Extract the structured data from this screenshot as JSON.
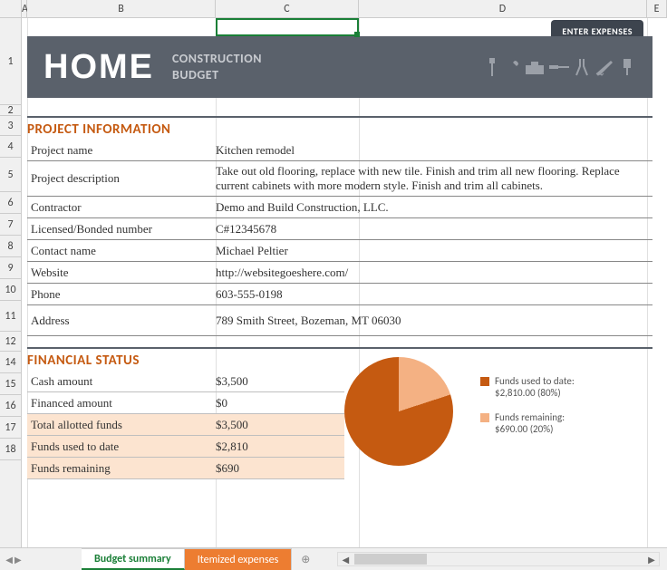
{
  "columns": [
    "A",
    "B",
    "C",
    "D",
    "E"
  ],
  "rows": [
    "1",
    "2",
    "3",
    "4",
    "5",
    "6",
    "7",
    "8",
    "9",
    "10",
    "11",
    "12",
    "14",
    "15",
    "16",
    "17",
    "18"
  ],
  "banner": {
    "title": "HOME",
    "subtitle_line1": "CONSTRUCTION",
    "subtitle_line2": "BUDGET",
    "enter_expenses": "ENTER EXPENSES"
  },
  "sections": {
    "project_info_title": "PROJECT INFORMATION",
    "financial_title": "FINANCIAL STATUS"
  },
  "project": {
    "name_label": "Project name",
    "name_value": "Kitchen remodel",
    "desc_label": "Project description",
    "desc_value": "Take out old flooring, replace with new tile. Finish and trim all new flooring. Replace current cabinets with more modern style. Finish and trim all cabinets.",
    "contractor_label": "Contractor",
    "contractor_value": "Demo and Build Construction, LLC.",
    "license_label": "Licensed/Bonded number",
    "license_value": "C#12345678",
    "contact_label": "Contact name",
    "contact_value": "Michael Peltier",
    "website_label": "Website",
    "website_value": "http://websitegoeshere.com/",
    "phone_label": "Phone",
    "phone_value": "603-555-0198",
    "address_label": "Address",
    "address_value": "789 Smith Street, Bozeman, MT 06030"
  },
  "financial": {
    "cash_label": "Cash amount",
    "cash_value": "$3,500",
    "financed_label": "Financed amount",
    "financed_value": "$0",
    "total_label": "Total allotted funds",
    "total_value": "$3,500",
    "used_label": "Funds used to date",
    "used_value": "$2,810",
    "remaining_label": "Funds remaining",
    "remaining_value": "$690"
  },
  "chart_data": {
    "type": "pie",
    "series": [
      {
        "name": "Funds used to date:",
        "value": 2810,
        "display": "$2,810.00 (80%)",
        "color": "#c55a11"
      },
      {
        "name": "Funds remaining:",
        "value": 690,
        "display": "$690.00 (20%)",
        "color": "#f4b183"
      }
    ]
  },
  "tabs": {
    "budget": "Budget summary",
    "itemized": "Itemized expenses"
  }
}
